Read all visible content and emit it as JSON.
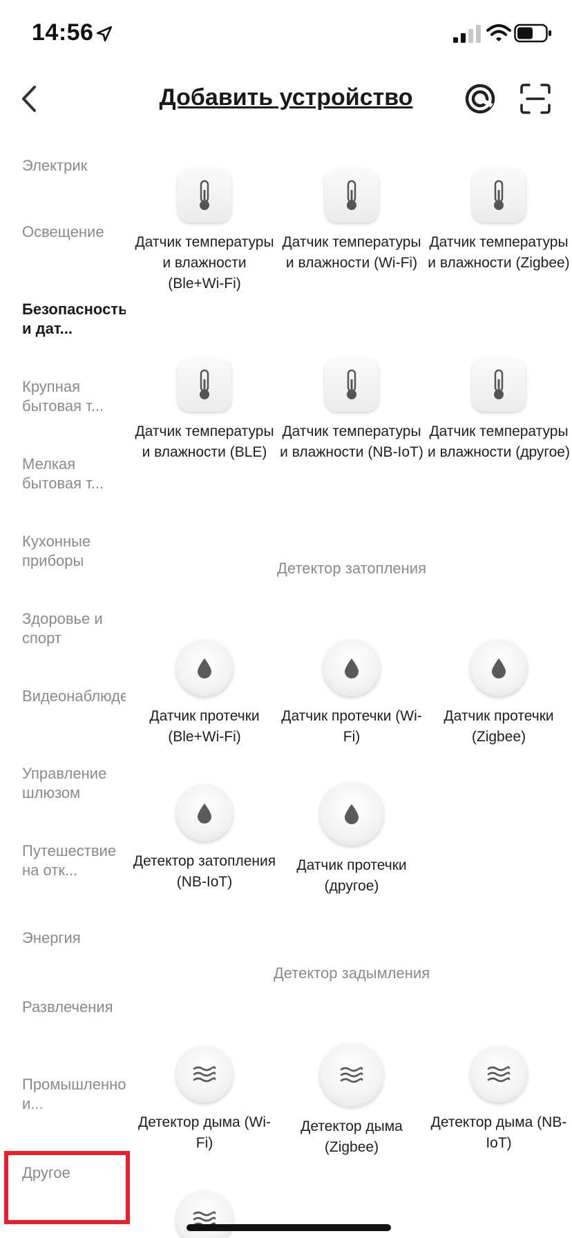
{
  "status_bar": {
    "time": "14:56"
  },
  "header": {
    "title": "Добавить устройство"
  },
  "sidebar": {
    "items": [
      {
        "label": "Электрик",
        "active": false
      },
      {
        "label": "Освещение",
        "active": false
      },
      {
        "label": "Безопасность и дат...",
        "active": true
      },
      {
        "label": "Крупная бытовая т...",
        "active": false
      },
      {
        "label": "Мелкая бытовая т...",
        "active": false
      },
      {
        "label": "Кухонные приборы",
        "active": false
      },
      {
        "label": "Здоровье и спорт",
        "active": false
      },
      {
        "label": "Видеонаблюдение",
        "active": false
      },
      {
        "label": "Управление шлюзом",
        "active": false
      },
      {
        "label": "Путешествие на отк...",
        "active": false
      },
      {
        "label": "Энергия",
        "active": false
      },
      {
        "label": "Развлечения",
        "active": false
      },
      {
        "label": "Промышленность и...",
        "active": false
      },
      {
        "label": "Другое",
        "active": false
      }
    ]
  },
  "devices": {
    "temp": [
      {
        "label": "Датчик температуры и влажности (Ble+Wi-Fi)"
      },
      {
        "label": "Датчик температуры и влажности (Wi-Fi)"
      },
      {
        "label": "Датчик температуры и влажности (Zigbee)"
      },
      {
        "label": "Датчик температуры и влажности (BLE)"
      },
      {
        "label": "Датчик температуры и влажности (NB-IoT)"
      },
      {
        "label": "Датчик температуры и влажности (другое)"
      }
    ],
    "flood_section": "Детектор затопления",
    "flood": [
      {
        "label": "Датчик протечки (Ble+Wi-Fi)"
      },
      {
        "label": "Датчик протечки (Wi-Fi)"
      },
      {
        "label": "Датчик протечки (Zigbee)"
      },
      {
        "label": "Детектор затопления (NB-IoT)"
      },
      {
        "label": "Датчик протечки (другое)"
      }
    ],
    "smoke_section": "Детектор задымления",
    "smoke": [
      {
        "label": "Детектор дыма (Wi-Fi)"
      },
      {
        "label": "Детектор дыма (Zigbee)"
      },
      {
        "label": "Детектор дыма (NB-IoT)"
      }
    ]
  },
  "icons": {
    "temp": "thermometer-icon",
    "flood": "water-drop-icon",
    "smoke": "smoke-waves-icon"
  },
  "colors": {
    "highlight": "#e8202c",
    "active_text": "#1a1a1a",
    "muted_text": "#8a8a8a"
  }
}
